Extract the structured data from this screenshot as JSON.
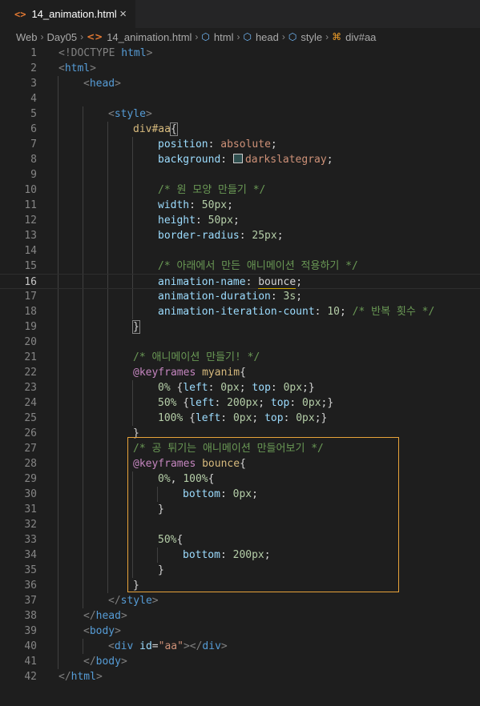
{
  "tab": {
    "icon": "html-file-icon",
    "label": "14_animation.html",
    "close": "×"
  },
  "breadcrumb": [
    {
      "label": "Web",
      "icon": ""
    },
    {
      "label": "Day05",
      "icon": ""
    },
    {
      "label": "14_animation.html",
      "icon": "html-file-icon"
    },
    {
      "label": "html",
      "icon": "element-icon"
    },
    {
      "label": "head",
      "icon": "element-icon"
    },
    {
      "label": "style",
      "icon": "element-icon"
    },
    {
      "label": "div#aa",
      "icon": "symbol-icon"
    }
  ],
  "editor": {
    "current_line": 16,
    "selection_lines": [
      27,
      36
    ],
    "lines": [
      {
        "n": 1,
        "indent": 0,
        "tokens": [
          [
            "<!DOCTYPE ",
            "punct"
          ],
          [
            "html",
            "kw"
          ],
          [
            ">",
            "punct"
          ]
        ]
      },
      {
        "n": 2,
        "indent": 0,
        "tokens": [
          [
            "<",
            "punct"
          ],
          [
            "html",
            "tag"
          ],
          [
            ">",
            "punct"
          ]
        ]
      },
      {
        "n": 3,
        "indent": 1,
        "tokens": [
          [
            "<",
            "punct"
          ],
          [
            "head",
            "tag"
          ],
          [
            ">",
            "punct"
          ]
        ]
      },
      {
        "n": 4,
        "indent": 0,
        "tokens": []
      },
      {
        "n": 5,
        "indent": 2,
        "tokens": [
          [
            "<",
            "punct"
          ],
          [
            "style",
            "tag"
          ],
          [
            ">",
            "punct"
          ]
        ]
      },
      {
        "n": 6,
        "indent": 3,
        "tokens": [
          [
            "div#aa",
            "sel"
          ],
          [
            "{",
            "brace"
          ]
        ]
      },
      {
        "n": 7,
        "indent": 4,
        "tokens": [
          [
            "position",
            "prop"
          ],
          [
            ": ",
            "text"
          ],
          [
            "absolute",
            "val"
          ],
          [
            ";",
            "text"
          ]
        ]
      },
      {
        "n": 8,
        "indent": 4,
        "tokens": [
          [
            "background",
            "prop"
          ],
          [
            ": ",
            "text"
          ],
          [
            "",
            "swatch"
          ],
          [
            "darkslategray",
            "val"
          ],
          [
            ";",
            "text"
          ]
        ]
      },
      {
        "n": 9,
        "indent": 0,
        "tokens": []
      },
      {
        "n": 10,
        "indent": 4,
        "tokens": [
          [
            "/* 원 모양 만들기 */",
            "comment"
          ]
        ]
      },
      {
        "n": 11,
        "indent": 4,
        "tokens": [
          [
            "width",
            "prop"
          ],
          [
            ": ",
            "text"
          ],
          [
            "50px",
            "num"
          ],
          [
            ";",
            "text"
          ]
        ]
      },
      {
        "n": 12,
        "indent": 4,
        "tokens": [
          [
            "height",
            "prop"
          ],
          [
            ": ",
            "text"
          ],
          [
            "50px",
            "num"
          ],
          [
            ";",
            "text"
          ]
        ]
      },
      {
        "n": 13,
        "indent": 4,
        "tokens": [
          [
            "border-radius",
            "prop"
          ],
          [
            ": ",
            "text"
          ],
          [
            "25px",
            "num"
          ],
          [
            ";",
            "text"
          ]
        ]
      },
      {
        "n": 14,
        "indent": 0,
        "tokens": []
      },
      {
        "n": 15,
        "indent": 4,
        "tokens": [
          [
            "/* 아래에서 만든 애니메이션 적용하기 */",
            "comment"
          ]
        ]
      },
      {
        "n": 16,
        "indent": 4,
        "tokens": [
          [
            "animation-name",
            "prop"
          ],
          [
            ": ",
            "text"
          ],
          [
            "bounce",
            "ident"
          ],
          [
            ";",
            "text"
          ]
        ]
      },
      {
        "n": 17,
        "indent": 4,
        "tokens": [
          [
            "animation-duration",
            "prop"
          ],
          [
            ": ",
            "text"
          ],
          [
            "3s",
            "num"
          ],
          [
            ";",
            "text"
          ]
        ]
      },
      {
        "n": 18,
        "indent": 4,
        "tokens": [
          [
            "animation-iteration-count",
            "prop"
          ],
          [
            ": ",
            "text"
          ],
          [
            "10",
            "num"
          ],
          [
            "; ",
            "text"
          ],
          [
            "/* 반복 횟수 */",
            "comment"
          ]
        ]
      },
      {
        "n": 19,
        "indent": 3,
        "tokens": [
          [
            "}",
            "brace"
          ]
        ]
      },
      {
        "n": 20,
        "indent": 0,
        "tokens": []
      },
      {
        "n": 21,
        "indent": 3,
        "tokens": [
          [
            "/* 애니메이션 만들기! */",
            "comment"
          ]
        ]
      },
      {
        "n": 22,
        "indent": 3,
        "tokens": [
          [
            "@keyframes",
            "at"
          ],
          [
            " ",
            "text"
          ],
          [
            "myanim",
            "sel"
          ],
          [
            "{",
            "text"
          ]
        ]
      },
      {
        "n": 23,
        "indent": 4,
        "tokens": [
          [
            "0%",
            "num"
          ],
          [
            " {",
            "text"
          ],
          [
            "left",
            "prop"
          ],
          [
            ": ",
            "text"
          ],
          [
            "0px",
            "num"
          ],
          [
            "; ",
            "text"
          ],
          [
            "top",
            "prop"
          ],
          [
            ": ",
            "text"
          ],
          [
            "0px",
            "num"
          ],
          [
            ";}",
            "text"
          ]
        ]
      },
      {
        "n": 24,
        "indent": 4,
        "tokens": [
          [
            "50%",
            "num"
          ],
          [
            " {",
            "text"
          ],
          [
            "left",
            "prop"
          ],
          [
            ": ",
            "text"
          ],
          [
            "200px",
            "num"
          ],
          [
            "; ",
            "text"
          ],
          [
            "top",
            "prop"
          ],
          [
            ": ",
            "text"
          ],
          [
            "0px",
            "num"
          ],
          [
            ";}",
            "text"
          ]
        ]
      },
      {
        "n": 25,
        "indent": 4,
        "tokens": [
          [
            "100%",
            "num"
          ],
          [
            " {",
            "text"
          ],
          [
            "left",
            "prop"
          ],
          [
            ": ",
            "text"
          ],
          [
            "0px",
            "num"
          ],
          [
            "; ",
            "text"
          ],
          [
            "top",
            "prop"
          ],
          [
            ": ",
            "text"
          ],
          [
            "0px",
            "num"
          ],
          [
            ";}",
            "text"
          ]
        ]
      },
      {
        "n": 26,
        "indent": 3,
        "tokens": [
          [
            "}",
            "text"
          ]
        ]
      },
      {
        "n": 27,
        "indent": 3,
        "tokens": [
          [
            "/* 공 튀기는 애니메이션 만들어보기 */",
            "comment"
          ]
        ]
      },
      {
        "n": 28,
        "indent": 3,
        "tokens": [
          [
            "@keyframes",
            "at"
          ],
          [
            " ",
            "text"
          ],
          [
            "bounce",
            "sel"
          ],
          [
            "{",
            "text"
          ]
        ]
      },
      {
        "n": 29,
        "indent": 4,
        "tokens": [
          [
            "0%",
            "num"
          ],
          [
            ", ",
            "text"
          ],
          [
            "100%",
            "num"
          ],
          [
            "{",
            "text"
          ]
        ]
      },
      {
        "n": 30,
        "indent": 5,
        "tokens": [
          [
            "bottom",
            "prop"
          ],
          [
            ": ",
            "text"
          ],
          [
            "0px",
            "num"
          ],
          [
            ";",
            "text"
          ]
        ]
      },
      {
        "n": 31,
        "indent": 4,
        "tokens": [
          [
            "}",
            "text"
          ]
        ]
      },
      {
        "n": 32,
        "indent": 0,
        "tokens": []
      },
      {
        "n": 33,
        "indent": 4,
        "tokens": [
          [
            "50%",
            "num"
          ],
          [
            "{",
            "text"
          ]
        ]
      },
      {
        "n": 34,
        "indent": 5,
        "tokens": [
          [
            "bottom",
            "prop"
          ],
          [
            ": ",
            "text"
          ],
          [
            "200px",
            "num"
          ],
          [
            ";",
            "text"
          ]
        ]
      },
      {
        "n": 35,
        "indent": 4,
        "tokens": [
          [
            "}",
            "text"
          ]
        ]
      },
      {
        "n": 36,
        "indent": 3,
        "tokens": [
          [
            "}",
            "text"
          ]
        ]
      },
      {
        "n": 37,
        "indent": 2,
        "tokens": [
          [
            "</",
            "punct"
          ],
          [
            "style",
            "tag"
          ],
          [
            ">",
            "punct"
          ]
        ]
      },
      {
        "n": 38,
        "indent": 1,
        "tokens": [
          [
            "</",
            "punct"
          ],
          [
            "head",
            "tag"
          ],
          [
            ">",
            "punct"
          ]
        ]
      },
      {
        "n": 39,
        "indent": 1,
        "tokens": [
          [
            "<",
            "punct"
          ],
          [
            "body",
            "tag"
          ],
          [
            ">",
            "punct"
          ]
        ]
      },
      {
        "n": 40,
        "indent": 2,
        "tokens": [
          [
            "<",
            "punct"
          ],
          [
            "div",
            "tag"
          ],
          [
            " ",
            "text"
          ],
          [
            "id",
            "attr"
          ],
          [
            "=",
            "text"
          ],
          [
            "\"aa\"",
            "str"
          ],
          [
            "></",
            "punct"
          ],
          [
            "div",
            "tag"
          ],
          [
            ">",
            "punct"
          ]
        ]
      },
      {
        "n": 41,
        "indent": 1,
        "tokens": [
          [
            "</",
            "punct"
          ],
          [
            "body",
            "tag"
          ],
          [
            ">",
            "punct"
          ]
        ]
      },
      {
        "n": 42,
        "indent": 0,
        "tokens": [
          [
            "</",
            "punct"
          ],
          [
            "html",
            "tag"
          ],
          [
            ">",
            "punct"
          ]
        ]
      }
    ]
  },
  "colors": {
    "punct": "#808080",
    "tag": "#569cd6",
    "kw": "#569cd6",
    "sel": "#d7ba7d",
    "prop": "#9cdcfe",
    "val": "#ce9178",
    "num": "#b5cea8",
    "comment": "#6a9955",
    "at": "#c586c0",
    "text": "#d4d4d4",
    "attr": "#9cdcfe",
    "str": "#ce9178",
    "ident": "#d4d4d4",
    "brace": "#d4d4d4",
    "selection_border": "#e8a33a"
  }
}
